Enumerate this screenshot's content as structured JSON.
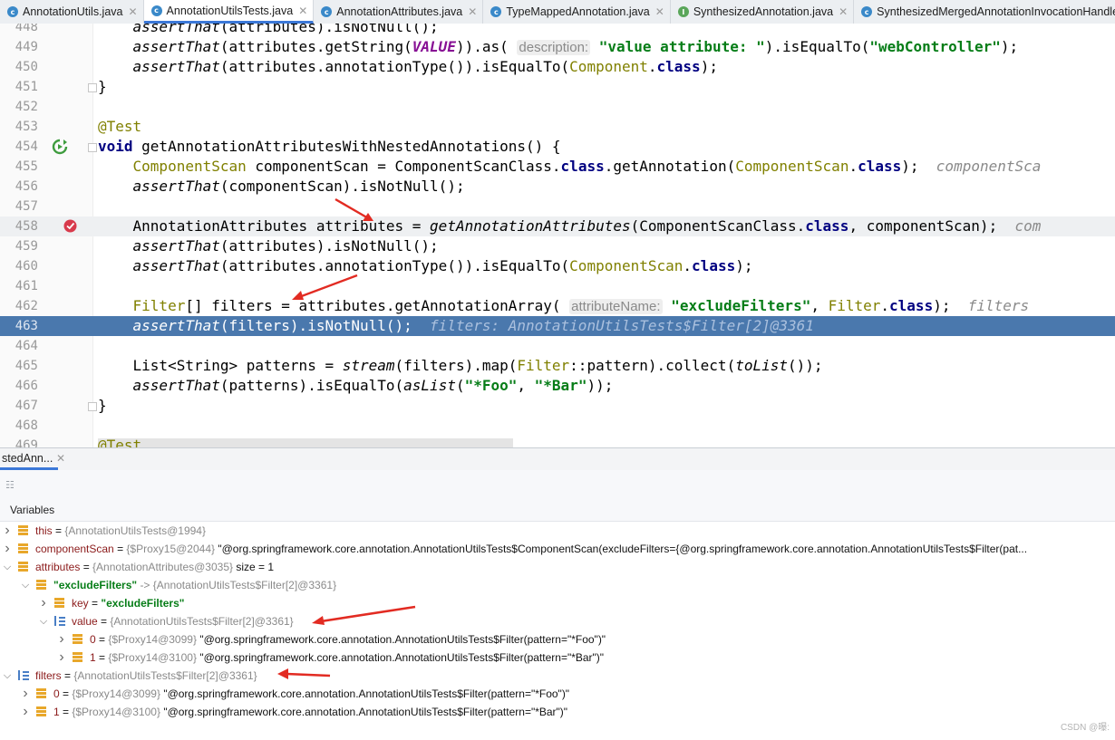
{
  "tabs": [
    {
      "icon": "class",
      "label": "AnnotationUtils.java",
      "active": false
    },
    {
      "icon": "class",
      "label": "AnnotationUtilsTests.java",
      "active": true
    },
    {
      "icon": "class",
      "label": "AnnotationAttributes.java",
      "active": false
    },
    {
      "icon": "class",
      "label": "TypeMappedAnnotation.java",
      "active": false
    },
    {
      "icon": "iface",
      "label": "SynthesizedAnnotation.java",
      "active": false
    },
    {
      "icon": "class",
      "label": "SynthesizedMergedAnnotationInvocationHandler.java",
      "active": false
    }
  ],
  "editor": {
    "line_numbers": [
      "448",
      "449",
      "450",
      "451",
      "452",
      "453",
      "454",
      "455",
      "456",
      "457",
      "458",
      "459",
      "460",
      "461",
      "462",
      "463",
      "464",
      "465",
      "466",
      "467",
      "468",
      "469"
    ],
    "current_line": "463",
    "breakpoint_line": "458",
    "hints": {
      "description": "description:",
      "attributeName": "attributeName:",
      "inline_455": "componentSca",
      "inline_458": "com",
      "inline_462": "filters",
      "inline_463": "filters: AnnotationUtilsTests$Filter[2]@3361"
    },
    "strings": {
      "value_attribute": "\"value attribute: \"",
      "webController": "\"webController\"",
      "excludeFilters": "\"excludeFilters\"",
      "foo": "\"*Foo\"",
      "bar": "\"*Bar\""
    }
  },
  "debug_tab": "stedAnn...",
  "variables_header": "Variables",
  "variables": [
    {
      "depth": 0,
      "expand": ">",
      "icon": "field",
      "name": "this",
      "name_style": "field",
      "type": "{AnnotationUtilsTests@1994}",
      "value": ""
    },
    {
      "depth": 0,
      "expand": ">",
      "icon": "field",
      "name": "componentScan",
      "name_style": "field",
      "type": "{$Proxy15@2044}",
      "value": "\"@org.springframework.core.annotation.AnnotationUtilsTests$ComponentScan(excludeFilters={@org.springframework.core.annotation.AnnotationUtilsTests$Filter(pat..."
    },
    {
      "depth": 0,
      "expand": "v",
      "icon": "field",
      "name": "attributes",
      "name_style": "field",
      "type": "{AnnotationAttributes@3035}",
      "value": " size = 1"
    },
    {
      "depth": 1,
      "expand": "v",
      "icon": "field",
      "name": "\"excludeFilters\"",
      "name_style": "str",
      "type": "-> {AnnotationUtilsTests$Filter[2]@3361}",
      "value": ""
    },
    {
      "depth": 2,
      "expand": ">",
      "icon": "field",
      "name": "key",
      "name_style": "field",
      "type": "",
      "value": "\"excludeFilters\"",
      "value_style": "str"
    },
    {
      "depth": 2,
      "expand": "v",
      "icon": "array",
      "name": "value",
      "name_style": "field",
      "type": "{AnnotationUtilsTests$Filter[2]@3361}",
      "value": ""
    },
    {
      "depth": 3,
      "expand": ">",
      "icon": "field",
      "name": "0",
      "name_style": "field",
      "type": "{$Proxy14@3099}",
      "value": "\"@org.springframework.core.annotation.AnnotationUtilsTests$Filter(pattern=\"*Foo\")\""
    },
    {
      "depth": 3,
      "expand": ">",
      "icon": "field",
      "name": "1",
      "name_style": "field",
      "type": "{$Proxy14@3100}",
      "value": "\"@org.springframework.core.annotation.AnnotationUtilsTests$Filter(pattern=\"*Bar\")\""
    },
    {
      "depth": 0,
      "expand": "v",
      "icon": "array",
      "name": "filters",
      "name_style": "field",
      "type": "{AnnotationUtilsTests$Filter[2]@3361}",
      "value": ""
    },
    {
      "depth": 1,
      "expand": ">",
      "icon": "field",
      "name": "0",
      "name_style": "field",
      "type": "{$Proxy14@3099}",
      "value": "\"@org.springframework.core.annotation.AnnotationUtilsTests$Filter(pattern=\"*Foo\")\""
    },
    {
      "depth": 1,
      "expand": ">",
      "icon": "field",
      "name": "1",
      "name_style": "field",
      "type": "{$Proxy14@3100}",
      "value": "\"@org.springframework.core.annotation.AnnotationUtilsTests$Filter(pattern=\"*Bar\")\""
    }
  ],
  "watermark": "CSDN @曝:",
  "colors": {
    "accent": "#3b78d8",
    "selected_line": "#4a78ad",
    "annotation_arrow": "#e22b22",
    "string": "#067d17",
    "keyword": "#000080"
  }
}
